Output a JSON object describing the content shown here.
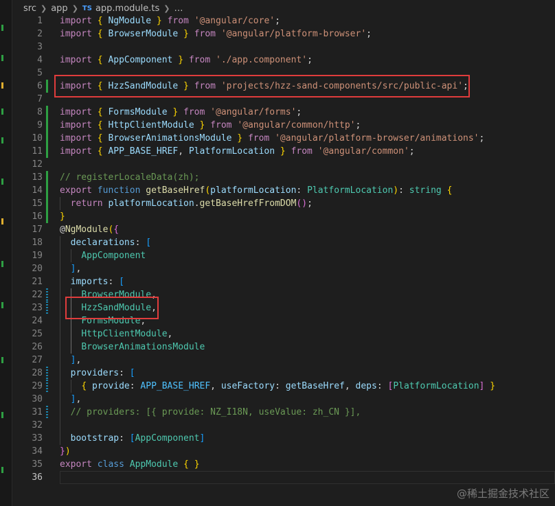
{
  "breadcrumb": {
    "parts": [
      "src",
      "app",
      "app.module.ts",
      "…"
    ],
    "file_badge": "TS"
  },
  "editor": {
    "current_line": 36,
    "lines": [
      {
        "n": "1",
        "tokens": [
          [
            "kw2",
            "import"
          ],
          [
            "pl",
            " "
          ],
          [
            "br1",
            "{"
          ],
          [
            "pl",
            " "
          ],
          [
            "var",
            "NgModule"
          ],
          [
            "pl",
            " "
          ],
          [
            "br1",
            "}"
          ],
          [
            "pl",
            " "
          ],
          [
            "kw2",
            "from"
          ],
          [
            "pl",
            " "
          ],
          [
            "str",
            "'@angular/core'"
          ],
          [
            "pl",
            ";"
          ]
        ]
      },
      {
        "n": "2",
        "tokens": [
          [
            "kw2",
            "import"
          ],
          [
            "pl",
            " "
          ],
          [
            "br1",
            "{"
          ],
          [
            "pl",
            " "
          ],
          [
            "var",
            "BrowserModule"
          ],
          [
            "pl",
            " "
          ],
          [
            "br1",
            "}"
          ],
          [
            "pl",
            " "
          ],
          [
            "kw2",
            "from"
          ],
          [
            "pl",
            " "
          ],
          [
            "str",
            "'@angular/platform-browser'"
          ],
          [
            "pl",
            ";"
          ]
        ]
      },
      {
        "n": "3",
        "tokens": []
      },
      {
        "n": "4",
        "tokens": [
          [
            "kw2",
            "import"
          ],
          [
            "pl",
            " "
          ],
          [
            "br1",
            "{"
          ],
          [
            "pl",
            " "
          ],
          [
            "var",
            "AppComponent"
          ],
          [
            "pl",
            " "
          ],
          [
            "br1",
            "}"
          ],
          [
            "pl",
            " "
          ],
          [
            "kw2",
            "from"
          ],
          [
            "pl",
            " "
          ],
          [
            "str",
            "'./app.component'"
          ],
          [
            "pl",
            ";"
          ]
        ]
      },
      {
        "n": "5",
        "tokens": []
      },
      {
        "n": "6",
        "tokens": [
          [
            "kw2",
            "import"
          ],
          [
            "pl",
            " "
          ],
          [
            "br1",
            "{"
          ],
          [
            "pl",
            " "
          ],
          [
            "var",
            "HzzSandModule"
          ],
          [
            "pl",
            " "
          ],
          [
            "br1",
            "}"
          ],
          [
            "pl",
            " "
          ],
          [
            "kw2",
            "from"
          ],
          [
            "pl",
            " "
          ],
          [
            "str",
            "'projects/hzz-sand-components/src/public-api'"
          ],
          [
            "pl",
            ";"
          ]
        ]
      },
      {
        "n": "7",
        "tokens": []
      },
      {
        "n": "8",
        "tokens": [
          [
            "kw2",
            "import"
          ],
          [
            "pl",
            " "
          ],
          [
            "br1",
            "{"
          ],
          [
            "pl",
            " "
          ],
          [
            "var",
            "FormsModule"
          ],
          [
            "pl",
            " "
          ],
          [
            "br1",
            "}"
          ],
          [
            "pl",
            " "
          ],
          [
            "kw2",
            "from"
          ],
          [
            "pl",
            " "
          ],
          [
            "str",
            "'@angular/forms'"
          ],
          [
            "pl",
            ";"
          ]
        ]
      },
      {
        "n": "9",
        "tokens": [
          [
            "kw2",
            "import"
          ],
          [
            "pl",
            " "
          ],
          [
            "br1",
            "{"
          ],
          [
            "pl",
            " "
          ],
          [
            "var",
            "HttpClientModule"
          ],
          [
            "pl",
            " "
          ],
          [
            "br1",
            "}"
          ],
          [
            "pl",
            " "
          ],
          [
            "kw2",
            "from"
          ],
          [
            "pl",
            " "
          ],
          [
            "str",
            "'@angular/common/http'"
          ],
          [
            "pl",
            ";"
          ]
        ]
      },
      {
        "n": "10",
        "tokens": [
          [
            "kw2",
            "import"
          ],
          [
            "pl",
            " "
          ],
          [
            "br1",
            "{"
          ],
          [
            "pl",
            " "
          ],
          [
            "var",
            "BrowserAnimationsModule"
          ],
          [
            "pl",
            " "
          ],
          [
            "br1",
            "}"
          ],
          [
            "pl",
            " "
          ],
          [
            "kw2",
            "from"
          ],
          [
            "pl",
            " "
          ],
          [
            "str",
            "'@angular/platform-browser/animations'"
          ],
          [
            "pl",
            ";"
          ]
        ]
      },
      {
        "n": "11",
        "tokens": [
          [
            "kw2",
            "import"
          ],
          [
            "pl",
            " "
          ],
          [
            "br1",
            "{"
          ],
          [
            "pl",
            " "
          ],
          [
            "var",
            "APP_BASE_HREF"
          ],
          [
            "pl",
            ", "
          ],
          [
            "var",
            "PlatformLocation"
          ],
          [
            "pl",
            " "
          ],
          [
            "br1",
            "}"
          ],
          [
            "pl",
            " "
          ],
          [
            "kw2",
            "from"
          ],
          [
            "pl",
            " "
          ],
          [
            "str",
            "'@angular/common'"
          ],
          [
            "pl",
            ";"
          ]
        ]
      },
      {
        "n": "12",
        "tokens": []
      },
      {
        "n": "13",
        "tokens": [
          [
            "cm",
            "// registerLocaleData(zh);"
          ]
        ]
      },
      {
        "n": "14",
        "tokens": [
          [
            "kw2",
            "export"
          ],
          [
            "pl",
            " "
          ],
          [
            "kw",
            "function"
          ],
          [
            "pl",
            " "
          ],
          [
            "fn",
            "getBaseHref"
          ],
          [
            "br1",
            "("
          ],
          [
            "var",
            "platformLocation"
          ],
          [
            "pl",
            ": "
          ],
          [
            "ty",
            "PlatformLocation"
          ],
          [
            "br1",
            ")"
          ],
          [
            "pl",
            ": "
          ],
          [
            "ty",
            "string"
          ],
          [
            "pl",
            " "
          ],
          [
            "br1",
            "{"
          ]
        ]
      },
      {
        "n": "15",
        "tokens": [
          [
            "pl",
            "  "
          ],
          [
            "kw2",
            "return"
          ],
          [
            "pl",
            " "
          ],
          [
            "var",
            "platformLocation"
          ],
          [
            "pl",
            "."
          ],
          [
            "fn",
            "getBaseHrefFromDOM"
          ],
          [
            "br2",
            "()"
          ],
          [
            "pl",
            ";"
          ]
        ]
      },
      {
        "n": "16",
        "tokens": [
          [
            "br1",
            "}"
          ]
        ]
      },
      {
        "n": "17",
        "tokens": [
          [
            "pl",
            "@"
          ],
          [
            "fn",
            "NgModule"
          ],
          [
            "br1",
            "("
          ],
          [
            "br2",
            "{"
          ]
        ]
      },
      {
        "n": "18",
        "tokens": [
          [
            "pl",
            "  "
          ],
          [
            "var",
            "declarations"
          ],
          [
            "pl",
            ": "
          ],
          [
            "br3",
            "["
          ]
        ]
      },
      {
        "n": "19",
        "tokens": [
          [
            "pl",
            "    "
          ],
          [
            "ty",
            "AppComponent"
          ]
        ]
      },
      {
        "n": "20",
        "tokens": [
          [
            "pl",
            "  "
          ],
          [
            "br3",
            "]"
          ],
          [
            "pl",
            ","
          ]
        ]
      },
      {
        "n": "21",
        "tokens": [
          [
            "pl",
            "  "
          ],
          [
            "var",
            "imports"
          ],
          [
            "pl",
            ": "
          ],
          [
            "br3",
            "["
          ]
        ]
      },
      {
        "n": "22",
        "tokens": [
          [
            "pl",
            "    "
          ],
          [
            "ty",
            "BrowserModule"
          ],
          [
            "pl",
            ","
          ]
        ]
      },
      {
        "n": "23",
        "tokens": [
          [
            "pl",
            "    "
          ],
          [
            "ty",
            "HzzSandModule"
          ],
          [
            "pl",
            ","
          ]
        ]
      },
      {
        "n": "24",
        "tokens": [
          [
            "pl",
            "    "
          ],
          [
            "ty",
            "FormsModule"
          ],
          [
            "pl",
            ","
          ]
        ]
      },
      {
        "n": "25",
        "tokens": [
          [
            "pl",
            "    "
          ],
          [
            "ty",
            "HttpClientModule"
          ],
          [
            "pl",
            ","
          ]
        ]
      },
      {
        "n": "26",
        "tokens": [
          [
            "pl",
            "    "
          ],
          [
            "ty",
            "BrowserAnimationsModule"
          ]
        ]
      },
      {
        "n": "27",
        "tokens": [
          [
            "pl",
            "  "
          ],
          [
            "br3",
            "]"
          ],
          [
            "pl",
            ","
          ]
        ]
      },
      {
        "n": "28",
        "tokens": [
          [
            "pl",
            "  "
          ],
          [
            "var",
            "providers"
          ],
          [
            "pl",
            ": "
          ],
          [
            "br3",
            "["
          ]
        ]
      },
      {
        "n": "29",
        "tokens": [
          [
            "pl",
            "    "
          ],
          [
            "br1",
            "{"
          ],
          [
            "pl",
            " "
          ],
          [
            "var",
            "provide"
          ],
          [
            "pl",
            ": "
          ],
          [
            "cst",
            "APP_BASE_HREF"
          ],
          [
            "pl",
            ", "
          ],
          [
            "var",
            "useFactory"
          ],
          [
            "pl",
            ": "
          ],
          [
            "var",
            "getBaseHref"
          ],
          [
            "pl",
            ", "
          ],
          [
            "var",
            "deps"
          ],
          [
            "pl",
            ": "
          ],
          [
            "br2",
            "["
          ],
          [
            "ty",
            "PlatformLocation"
          ],
          [
            "br2",
            "]"
          ],
          [
            "pl",
            " "
          ],
          [
            "br1",
            "}"
          ]
        ]
      },
      {
        "n": "30",
        "tokens": [
          [
            "pl",
            "  "
          ],
          [
            "br3",
            "]"
          ],
          [
            "pl",
            ","
          ]
        ]
      },
      {
        "n": "31",
        "tokens": [
          [
            "pl",
            "  "
          ],
          [
            "cm",
            "// providers: [{ provide: NZ_I18N, useValue: zh_CN }],"
          ]
        ]
      },
      {
        "n": "32",
        "tokens": []
      },
      {
        "n": "33",
        "tokens": [
          [
            "pl",
            "  "
          ],
          [
            "var",
            "bootstrap"
          ],
          [
            "pl",
            ": "
          ],
          [
            "br3",
            "["
          ],
          [
            "ty",
            "AppComponent"
          ],
          [
            "br3",
            "]"
          ]
        ]
      },
      {
        "n": "34",
        "tokens": [
          [
            "br2",
            "}"
          ],
          [
            "br1",
            ")"
          ]
        ]
      },
      {
        "n": "35",
        "tokens": [
          [
            "kw2",
            "export"
          ],
          [
            "pl",
            " "
          ],
          [
            "kw",
            "class"
          ],
          [
            "pl",
            " "
          ],
          [
            "ty",
            "AppModule"
          ],
          [
            "pl",
            " "
          ],
          [
            "br1",
            "{"
          ],
          [
            "pl",
            " "
          ],
          [
            "br1",
            "}"
          ]
        ]
      },
      {
        "n": "36",
        "tokens": []
      }
    ]
  },
  "annotations": [
    "highlight-import-line-6",
    "highlight-imports-item-23"
  ],
  "watermark": "@稀土掘金技术社区",
  "colors": {
    "background": "#1e1e1e",
    "keyword_control": "#c586c0",
    "keyword": "#569cd6",
    "string": "#ce9178",
    "type": "#4ec9b0",
    "function": "#dcdcaa",
    "variable": "#9cdcfe",
    "comment": "#6a9955",
    "highlight_box": "#e03c3c",
    "git_added": "#2ea043"
  }
}
